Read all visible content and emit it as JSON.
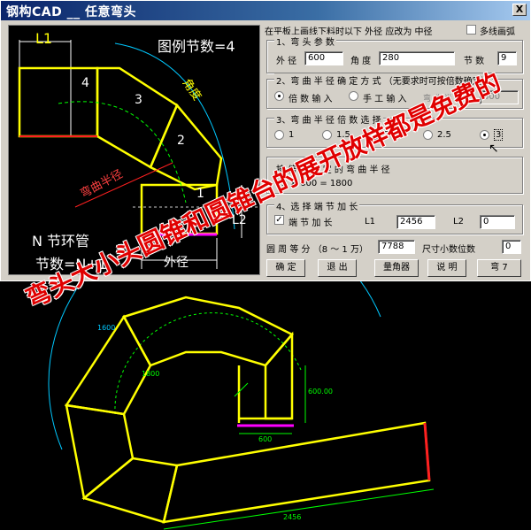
{
  "window": {
    "title": "钢构CAD __ 任意弯头",
    "close_label": "X"
  },
  "preview": {
    "l1_label": "L1",
    "l2_label": "L2",
    "legend_label": "图例节数=4",
    "angle_label": "角度",
    "radius_label": "弯曲半径",
    "ring_label": "N 节环管",
    "count_label": "节数=N+1",
    "diameter_label": "外径",
    "segment_numbers": [
      "1",
      "2",
      "3",
      "4"
    ]
  },
  "form": {
    "top_note": "在平板上画线下料时以下 外径 应改为 中径",
    "multiline_label": "多线画弧",
    "group1": {
      "title": "1、弯 头 参 数",
      "diameter_label": "外 径",
      "diameter_value": "600",
      "angle_label": "角 度",
      "angle_value": "280",
      "count_label": "节 数",
      "count_value": "9"
    },
    "group2": {
      "title": "2、弯 曲 半 径 确 定 方 式 （无要求时可按倍数确定）",
      "option_multiple": "倍 数 输 入",
      "option_manual": "手 工 输 入",
      "radius_label": "弯 曲 半 径",
      "radius_value": "600"
    },
    "group3": {
      "title": "3、弯 曲 半 径 倍 数 选 择",
      "options": [
        "1",
        "1.5",
        "2",
        "2.5",
        "3"
      ],
      "selected": "3"
    },
    "computed": {
      "title": "按 倍 数 确 定 的 弯 曲 半 径",
      "formula": "3 × 600 = 1800"
    },
    "group4": {
      "title": "4、选 择 端 节 加 长",
      "check_label": "端 节 加 长",
      "l1_label": "L1",
      "l1_value": "2456",
      "l2_label": "L2",
      "l2_value": "0"
    },
    "circle": {
      "label": "圆 周 等 分 （8 ～ 1 万）",
      "value": "7788",
      "size_label": "尺寸小数位数",
      "size_value": "0"
    },
    "buttons": {
      "ok": "确 定",
      "exit": "退 出",
      "angle_tool": "量角器",
      "help": "说 明",
      "bend": "弯 7"
    }
  },
  "cad": {
    "dim_bottom": "2456",
    "dim_small": "600",
    "dim_radius": "1800",
    "dim_r2": "1600",
    "dim_side": "600.00"
  },
  "watermark": "弯头大小头圆锥和圆锥台的展开放样都是免费的",
  "colors": {
    "yellow": "#ffff00",
    "green": "#00ff00",
    "cyan": "#00c8ff",
    "magenta": "#ff00ff",
    "red": "#ff2020"
  }
}
